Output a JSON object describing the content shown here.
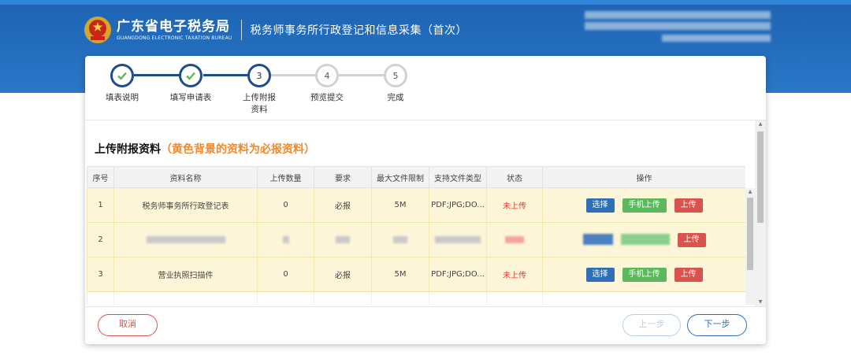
{
  "header": {
    "brand_cn": "广东省电子税务局",
    "brand_en": "GUANGDONG ELECTRONIC TAXATION BUREAU",
    "page_title": "税务师事务所行政登记和信息采集（首次）"
  },
  "steps": [
    {
      "label": "填表说明",
      "state": "done",
      "number": ""
    },
    {
      "label": "填写申请表",
      "state": "done",
      "number": ""
    },
    {
      "label": "上传附报资料",
      "state": "active",
      "number": "3"
    },
    {
      "label": "预览提交",
      "state": "todo",
      "number": "4"
    },
    {
      "label": "完成",
      "state": "todo",
      "number": "5"
    }
  ],
  "section": {
    "title": "上传附报资料",
    "note": "（黄色背景的资料为必报资料）"
  },
  "table": {
    "headers": [
      "序号",
      "资料名称",
      "上传数量",
      "要求",
      "最大文件限制",
      "支持文件类型",
      "状态",
      "操作"
    ],
    "rows": [
      {
        "index": "1",
        "name": "税务师事务所行政登记表",
        "count": "0",
        "requirement": "必报",
        "max_size": "5M",
        "types": "PDF;JPG;DO...",
        "status": "未上传"
      },
      {
        "index": "2",
        "name": "",
        "count": "",
        "requirement": "",
        "max_size": "",
        "types": "",
        "status": ""
      },
      {
        "index": "3",
        "name": "营业执照扫描件",
        "count": "0",
        "requirement": "必报",
        "max_size": "5M",
        "types": "PDF;JPG;DO...",
        "status": "未上传"
      }
    ],
    "actions": {
      "select": "选择",
      "mobile_upload": "手机上传",
      "upload": "上传"
    }
  },
  "footer": {
    "cancel": "取消",
    "prev": "上一步",
    "next": "下一步"
  },
  "colors": {
    "header_blue": "#1d63b2",
    "step_done": "#1e4d8c",
    "required_row": "#fdf5d7",
    "note_orange": "#f08a2b",
    "status_red": "#e53935"
  },
  "icons": {
    "emblem": "national-emblem-icon",
    "step_done": "check-icon"
  }
}
